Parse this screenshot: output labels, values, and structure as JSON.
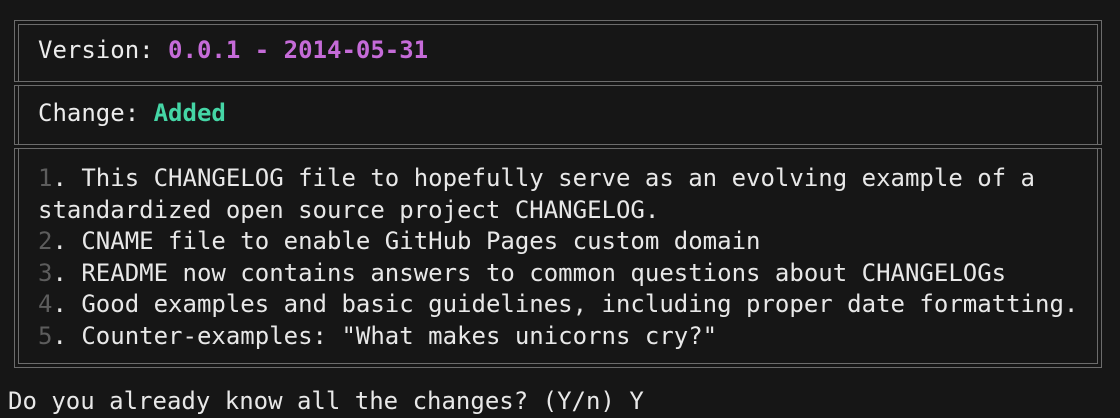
{
  "header": {
    "version_label": "Version: ",
    "version_value": "0.0.1 - 2014-05-31",
    "change_label": "Change: ",
    "change_value": "Added"
  },
  "items": [
    {
      "num": "1",
      "lines": [
        "This CHANGELOG file to hopefully serve as an evolving example of a",
        "standardized open source project CHANGELOG."
      ]
    },
    {
      "num": "2",
      "lines": [
        "CNAME file to enable GitHub Pages custom domain"
      ]
    },
    {
      "num": "3",
      "lines": [
        "README now contains answers to common questions about CHANGELOGs"
      ]
    },
    {
      "num": "4",
      "lines": [
        "Good examples and basic guidelines, including proper date formatting."
      ]
    },
    {
      "num": "5",
      "lines": [
        "Counter-examples: \"What makes unicorns cry?\""
      ]
    }
  ],
  "prompt": {
    "question": "Do you already know all the changes? (Y/n)",
    "answer": "Y"
  },
  "colors": {
    "version": "#c56bd8",
    "change": "#45d6a6",
    "number": "#5d5d5d",
    "border": "#6c6c6c",
    "background": "#161616"
  }
}
